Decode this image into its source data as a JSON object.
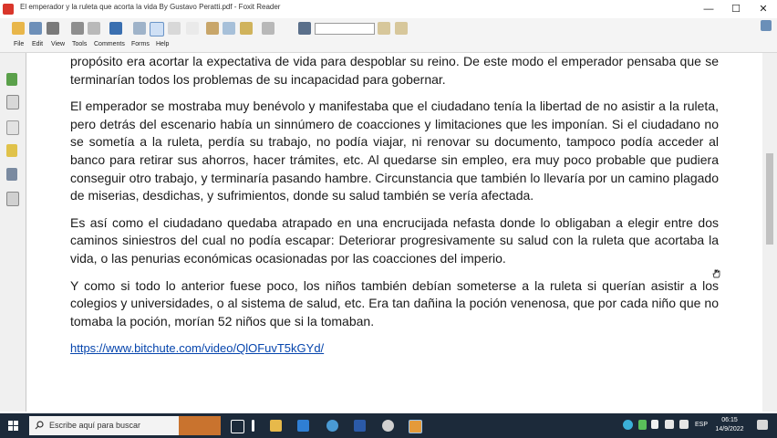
{
  "window": {
    "title": "El emperador y la ruleta que acorta la vida By Gustavo Peratti.pdf - Foxit Reader",
    "minimize": "—",
    "maximize": "☐",
    "close": "✕"
  },
  "menu": [
    "File",
    "Edit",
    "View",
    "Tools",
    "Comments",
    "Forms",
    "Help"
  ],
  "toolbar": {
    "search_value": ""
  },
  "document": {
    "paragraphs": [
      "propósito era acortar la expectativa de vida para despoblar su reino. De este modo el emperador pensaba que se terminarían todos los problemas de su incapacidad para gobernar.",
      "El emperador se mostraba muy benévolo y manifestaba que el ciudadano tenía la libertad de no asistir a la ruleta, pero detrás del escenario había un sinnúmero de coacciones y limitaciones que les imponían. Si el ciudadano no se sometía a la ruleta, perdía su trabajo, no podía viajar, ni renovar su documento, tampoco podía acceder al banco para retirar sus ahorros, hacer trámites, etc. Al quedarse sin empleo, era muy poco probable que pudiera conseguir otro trabajo, y terminaría pasando hambre. Circunstancia que también lo llevaría por un camino plagado de miserias, desdichas, y sufrimientos, donde su salud también se vería afectada.",
      "Es así como el ciudadano quedaba atrapado en una encrucijada nefasta donde lo obligaban a elegir entre dos caminos siniestros del cual no podía escapar: Deteriorar progresivamente su salud con la ruleta que acortaba la vida, o las penurias económicas ocasionadas por las coacciones del imperio.",
      "Y como si todo lo anterior fuese poco, los niños también debían someterse a la ruleta si querían asistir a los colegios y universidades, o al sistema de salud, etc. Era tan dañina la poción venenosa, que por cada niño que no tomaba la poción, morían 52 niños que si la tomaban."
    ],
    "link": "https://www.bitchute.com/video/QlOFuvT5kGYd/"
  },
  "taskbar": {
    "search_placeholder": "Escribe aquí para buscar",
    "language": "ESP",
    "time": "06:15",
    "date": "14/9/2022"
  },
  "colors": {
    "taskbar": "#1c2a3a",
    "link": "#0645ad",
    "pdf_icon": "#d9362b"
  }
}
